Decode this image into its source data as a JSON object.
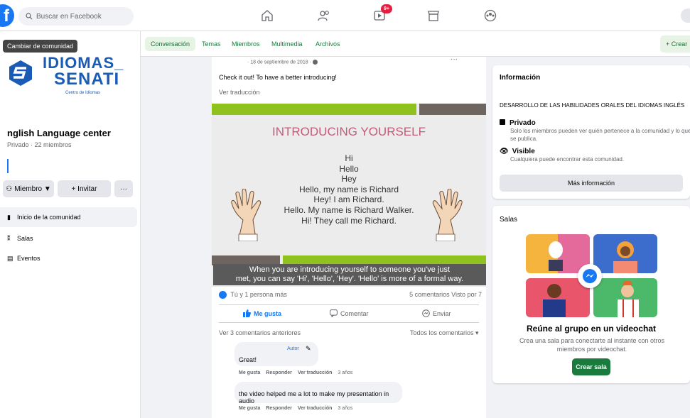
{
  "topbar": {
    "logo": "f",
    "search_placeholder": "Buscar en Facebook",
    "notif_count": "9+"
  },
  "sidebar": {
    "tooltip": "Cambiar de comunidad",
    "brand_line1": "IDIOMAS_",
    "brand_line2": "SENATI",
    "brand_sub": "Centro de Idiomas",
    "group_name": "nglish Language center",
    "group_meta": "Privado · 22 miembros",
    "member_btn": "Miembro ▼",
    "invite_btn": "+ Invitar",
    "more_btn": "···",
    "items": [
      {
        "label": "Inicio de la comunidad"
      },
      {
        "label": "Salas"
      },
      {
        "label": "Eventos"
      }
    ]
  },
  "tabs": {
    "items": [
      "Conversación",
      "Temas",
      "Miembros",
      "Multimedia",
      "Archivos"
    ],
    "create": "+ Crear"
  },
  "post": {
    "date": "· 18 de septiembre de 2018 ·",
    "dots": "···",
    "text": "Check it out! To have a better introducing!",
    "translate": "Ver traducción",
    "slide": {
      "title": "INTRODUCING YOURSELF",
      "lines": [
        "Hi",
        "Hello",
        "Hey",
        "Hello, my name is Richard",
        "Hey! I am Richard.",
        "Hello. My name is Richard Walker.",
        "Hi! They call me Richard."
      ],
      "caption1": "When you are introducing yourself to someone you've just",
      "caption2": "met, you can say 'Hi', 'Hello', 'Hey'. 'Hello' is more of a formal way."
    },
    "reactions": "Tú y 1 persona más",
    "stats": "5 comentarios  Visto por 7",
    "like": "Me gusta",
    "comment": "Comentar",
    "send": "Enviar",
    "prev_comments": "Ver 3 comentarios anteriores",
    "all_comments": "Todos los comentarios ▾",
    "comments": [
      {
        "badge": "Autor",
        "text": "Great!",
        "actions": [
          "Me gusta",
          "Responder",
          "Ver traducción",
          "3 años"
        ]
      },
      {
        "text": "the video helped me a lot to make my presentation in audio",
        "actions": [
          "Me gusta",
          "Responder",
          "Ver traducción",
          "3 años"
        ]
      }
    ]
  },
  "info": {
    "title": "Información",
    "description": "DESARROLLO DE LAS HABILIDADES ORALES DEL IDIOMAS INGLÉS",
    "private_head": "Privado",
    "private_sub": "Solo los miembros pueden ver quién pertenece a la comunidad y lo que se publica.",
    "visible_head": "Visible",
    "visible_sub": "Cualquiera puede encontrar esta comunidad.",
    "more": "Más información"
  },
  "rooms": {
    "title": "Salas",
    "meet_title": "Reúne al grupo en un videochat",
    "meet_desc": "Crea una sala para conectarte al instante con otros miembros por videochat.",
    "create": "Crear sala"
  }
}
